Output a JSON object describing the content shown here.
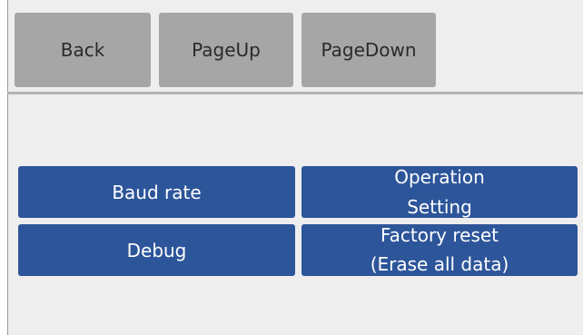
{
  "toolbar": {
    "back_label": "Back",
    "pageup_label": "PageUp",
    "pagedown_label": "PageDown"
  },
  "menu": {
    "baud_rate_label": "Baud rate",
    "operation_setting_line1": "Operation",
    "operation_setting_line2": "Setting",
    "debug_label": "Debug",
    "factory_reset_line1": "Factory reset",
    "factory_reset_line2": "(Erase all data)"
  },
  "colors": {
    "nav_button": "#a6a6a6",
    "menu_button": "#2d559a",
    "panel_background": "#eeeeee",
    "menu_text": "#ffffff"
  }
}
